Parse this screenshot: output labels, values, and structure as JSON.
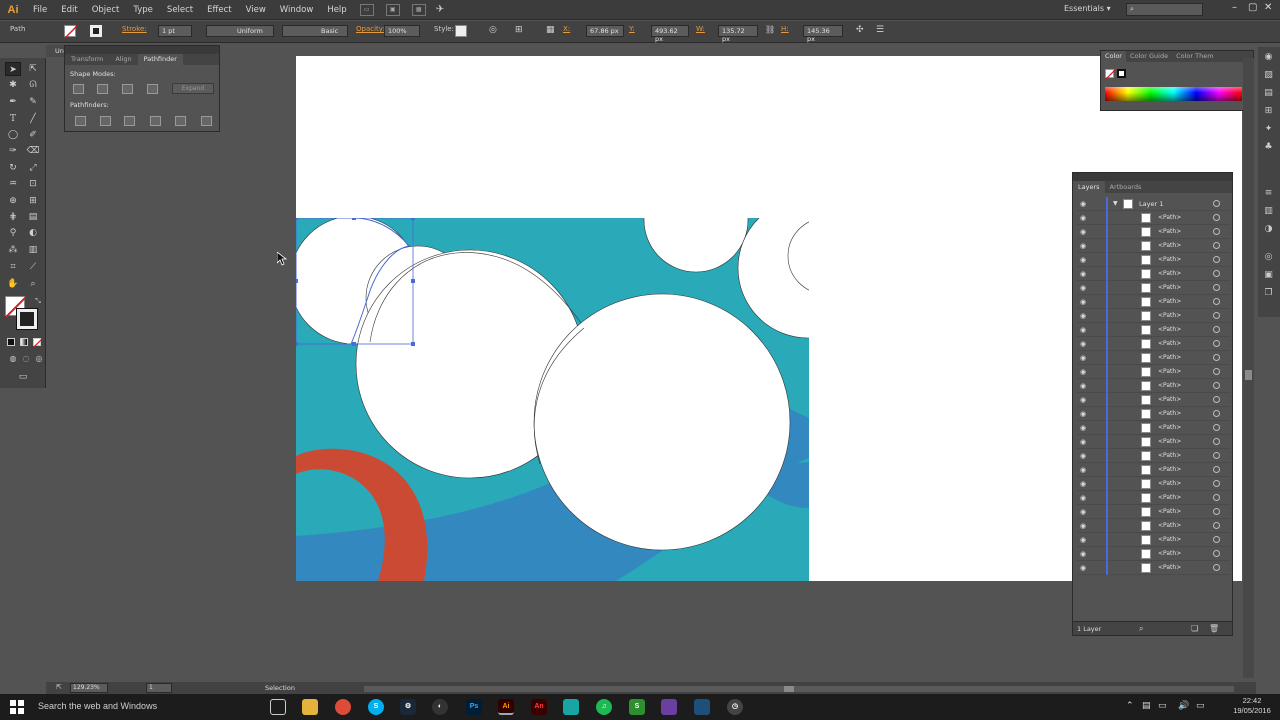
{
  "app": {
    "logo": "Ai"
  },
  "menu": [
    "File",
    "Edit",
    "Object",
    "Type",
    "Select",
    "Effect",
    "View",
    "Window",
    "Help"
  ],
  "workspace": "Essentials",
  "control_bar": {
    "selection_type": "Path",
    "stroke_label": "Stroke:",
    "stroke_weight": "1 pt",
    "stroke_profile": "Uniform",
    "brush": "Basic",
    "opacity_label": "Opacity:",
    "opacity": "100%",
    "style_label": "Style:",
    "x_label": "X:",
    "x_value": "67.86 px",
    "y_label": "Y:",
    "y_value": "493.62 px",
    "w_label": "W:",
    "w_value": "135.72 px",
    "h_label": "H:",
    "h_value": "145.36 px"
  },
  "pathfinder": {
    "tabs": [
      "Transform",
      "Align",
      "Pathfinder"
    ],
    "shape_modes_label": "Shape Modes:",
    "pathfinders_label": "Pathfinders:",
    "expand_label": "Expand"
  },
  "color_panel": {
    "tabs": [
      "Color",
      "Color Guide",
      "Color Them"
    ]
  },
  "layers_panel": {
    "tabs": [
      "Layers",
      "Artboards"
    ],
    "layer_name": "Layer 1",
    "path_label": "<Path>",
    "path_count": 26,
    "footer": "1 Layer"
  },
  "artwork_colors": {
    "teal": "#2aa9b8",
    "blue": "#3488c0",
    "red": "#cb4a33",
    "white": "#ffffff",
    "selection": "#4a6ad6"
  },
  "status_bar": {
    "zoom": "129.23%",
    "artboard": "1",
    "tool": "Selection"
  },
  "taskbar": {
    "search": "Search the web and Windows",
    "time": "22:42",
    "date": "19/05/2016"
  }
}
